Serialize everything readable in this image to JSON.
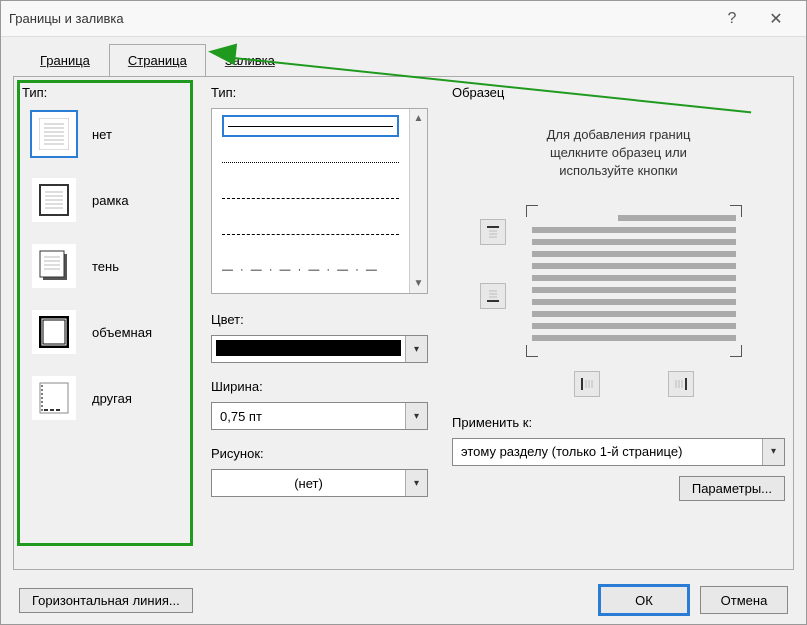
{
  "window": {
    "title": "Границы и заливка"
  },
  "tabs": {
    "border": "Граница",
    "page": "Страница",
    "shading": "Заливка"
  },
  "settings": {
    "group_label": "Тип:",
    "items": [
      {
        "label": "нет"
      },
      {
        "label": "рамка"
      },
      {
        "label": "тень"
      },
      {
        "label": "объемная"
      },
      {
        "label": "другая"
      }
    ]
  },
  "style": {
    "group_label": "Тип:"
  },
  "color": {
    "label": "Цвет:",
    "value": "#000000"
  },
  "width": {
    "label": "Ширина:",
    "value": "0,75 пт"
  },
  "art": {
    "label": "Рисунок:",
    "value": "(нет)"
  },
  "preview": {
    "group_label": "Образец",
    "hint_line1": "Для добавления границ",
    "hint_line2": "щелкните образец или",
    "hint_line3": "используйте кнопки"
  },
  "apply": {
    "label": "Применить к:",
    "value": "этому разделу (только 1-й странице)"
  },
  "options_button": "Параметры...",
  "footer": {
    "hline": "Горизонтальная линия...",
    "ok": "ОК",
    "cancel": "Отмена"
  }
}
